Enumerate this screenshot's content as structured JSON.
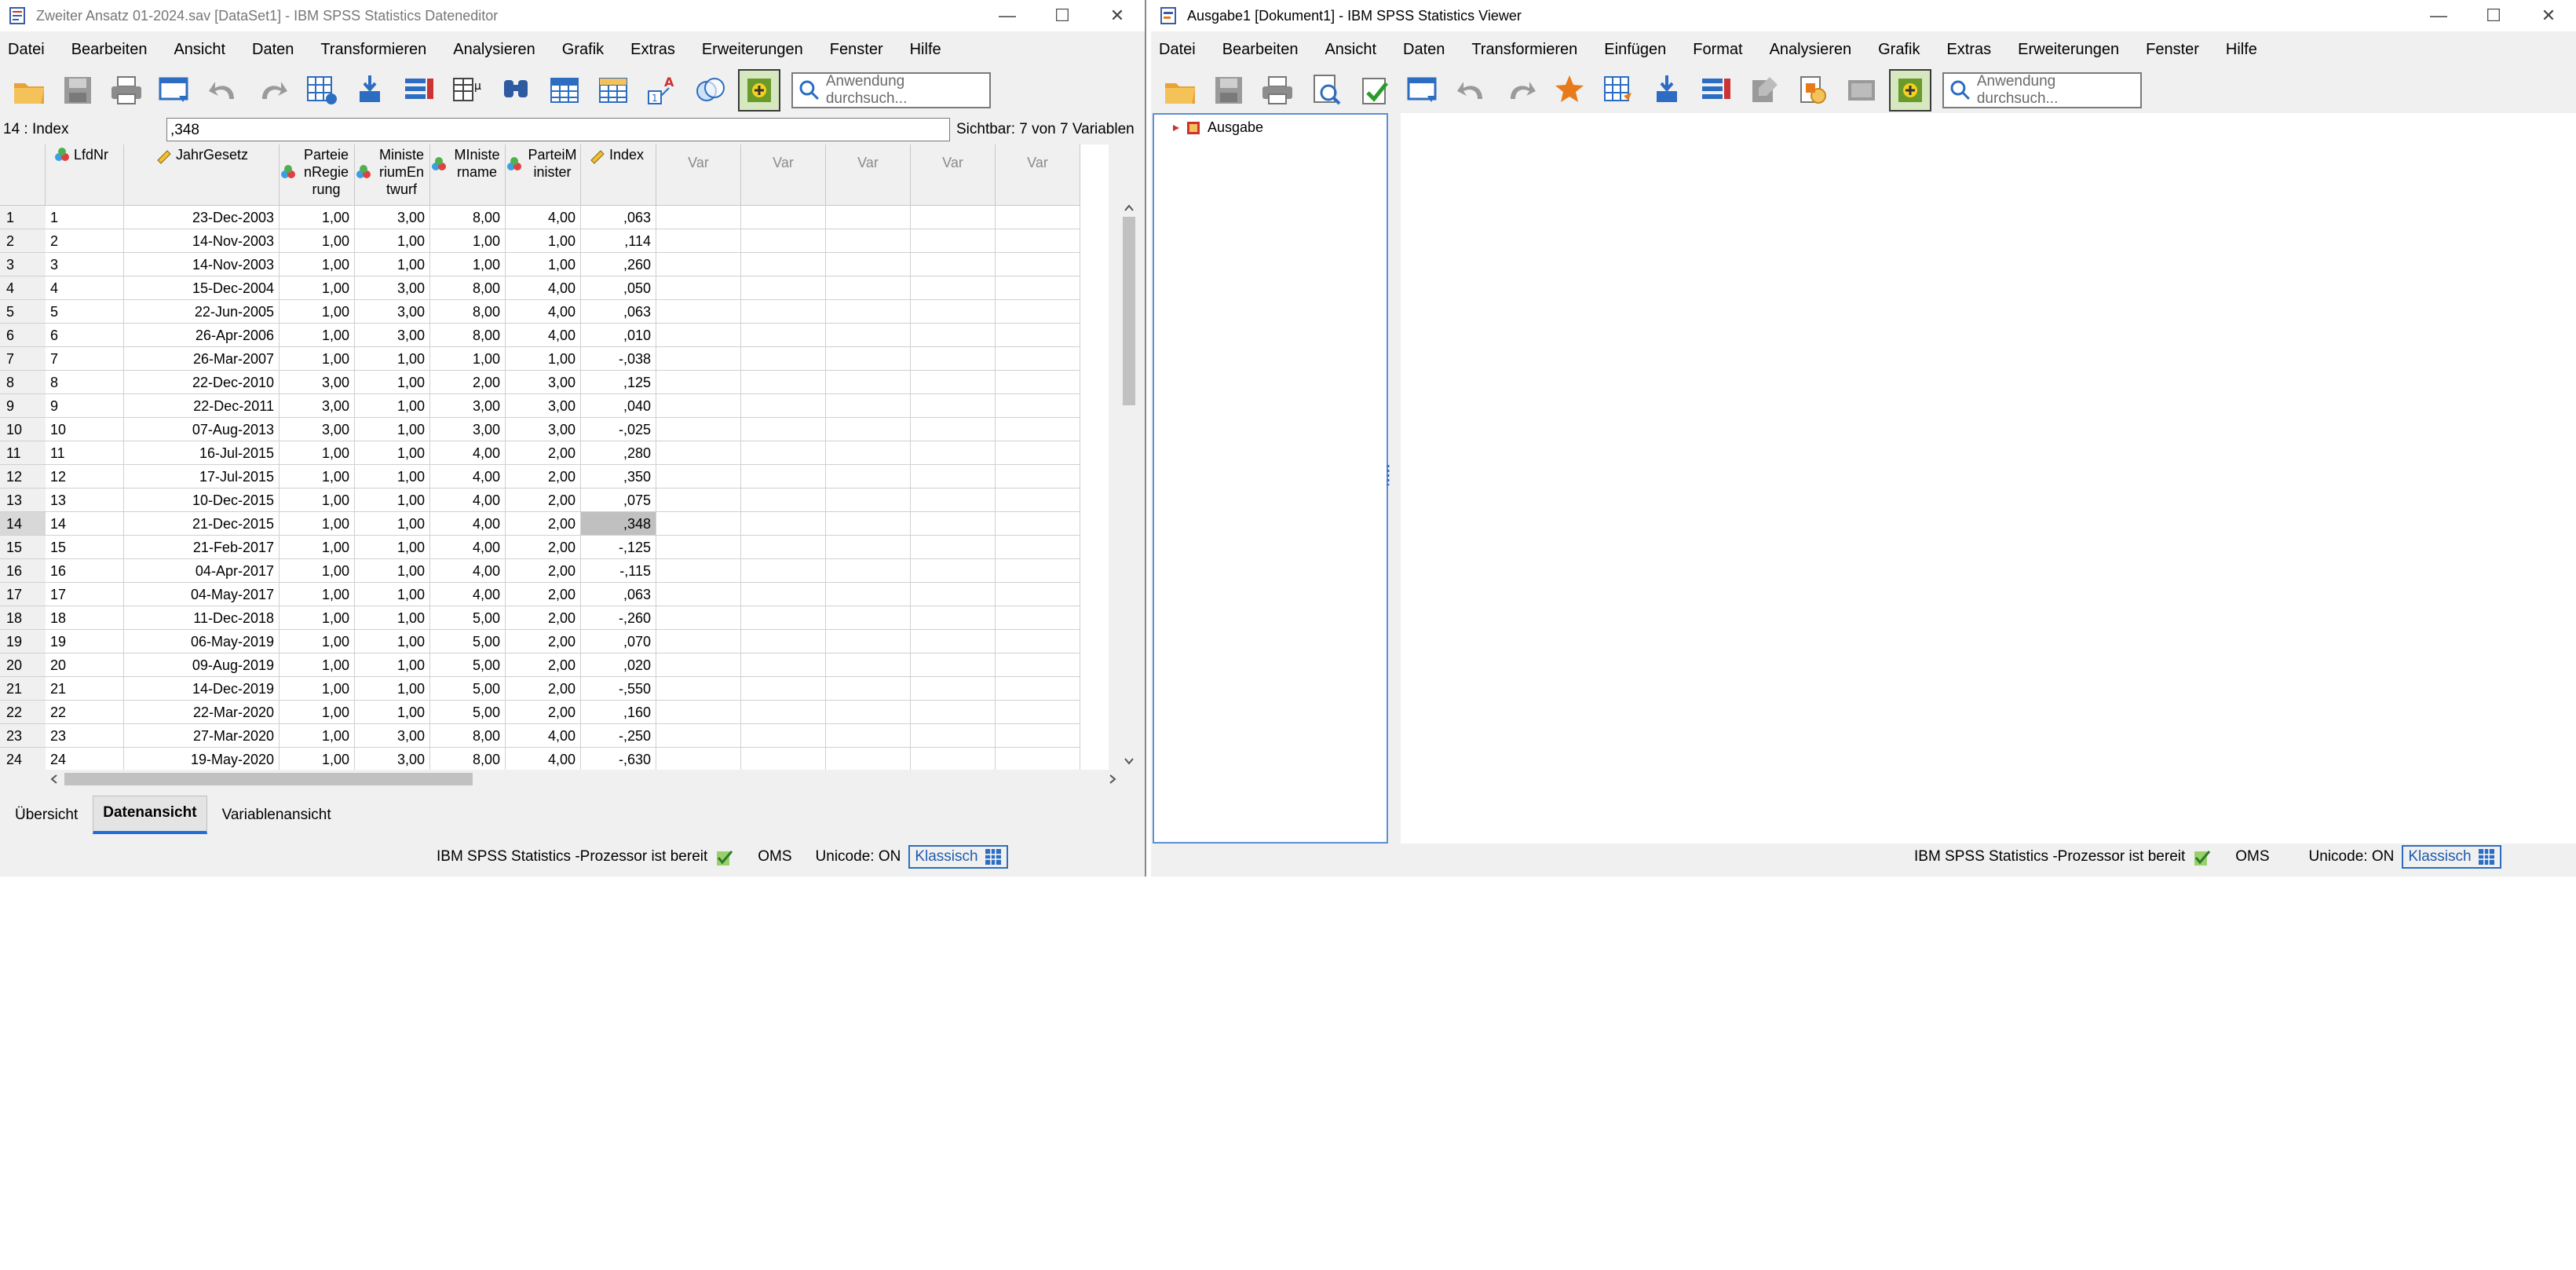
{
  "editor": {
    "title": "Zweiter Ansatz 01-2024.sav [DataSet1] - IBM SPSS Statistics Dateneditor",
    "menu": [
      "Datei",
      "Bearbeiten",
      "Ansicht",
      "Daten",
      "Transformieren",
      "Analysieren",
      "Grafik",
      "Extras",
      "Erweiterungen",
      "Fenster",
      "Hilfe"
    ],
    "search_placeholder": "Anwendung durchsuch...",
    "cell_ref": "14 : Index",
    "cell_value": ",348",
    "visible_vars": "Sichtbar: 7 von 7 Variablen",
    "columns": [
      {
        "name": "LfdNr",
        "lines": [
          "LfdNr"
        ],
        "icon": "nominal-icon"
      },
      {
        "name": "JahrGesetz",
        "lines": [
          "JahrGesetz"
        ],
        "icon": "scale-icon"
      },
      {
        "name": "ParteienRegierung",
        "lines": [
          "Parteie",
          "nRegie",
          "rung"
        ],
        "icon": "nominal-icon"
      },
      {
        "name": "MinisteriumEntwurf",
        "lines": [
          "Ministe",
          "riumEn",
          "twurf"
        ],
        "icon": "nominal-icon"
      },
      {
        "name": "Ministername",
        "lines": [
          "MIniste",
          "rname"
        ],
        "icon": "nominal-icon"
      },
      {
        "name": "ParteiMinister",
        "lines": [
          "ParteiM",
          "inister"
        ],
        "icon": "nominal-icon"
      },
      {
        "name": "Index",
        "lines": [
          "Index"
        ],
        "icon": "scale-icon"
      },
      {
        "name": "Var",
        "lines": [
          "Var"
        ],
        "icon": ""
      },
      {
        "name": "Var",
        "lines": [
          "Var"
        ],
        "icon": ""
      },
      {
        "name": "Var",
        "lines": [
          "Var"
        ],
        "icon": ""
      },
      {
        "name": "Var",
        "lines": [
          "Var"
        ],
        "icon": ""
      },
      {
        "name": "Var",
        "lines": [
          "Var"
        ],
        "icon": ""
      }
    ],
    "rows": [
      [
        "1",
        "1",
        "23-Dec-2003",
        "1,00",
        "3,00",
        "8,00",
        "4,00",
        ",063"
      ],
      [
        "2",
        "2",
        "14-Nov-2003",
        "1,00",
        "1,00",
        "1,00",
        "1,00",
        ",114"
      ],
      [
        "3",
        "3",
        "14-Nov-2003",
        "1,00",
        "1,00",
        "1,00",
        "1,00",
        ",260"
      ],
      [
        "4",
        "4",
        "15-Dec-2004",
        "1,00",
        "3,00",
        "8,00",
        "4,00",
        ",050"
      ],
      [
        "5",
        "5",
        "22-Jun-2005",
        "1,00",
        "3,00",
        "8,00",
        "4,00",
        ",063"
      ],
      [
        "6",
        "6",
        "26-Apr-2006",
        "1,00",
        "3,00",
        "8,00",
        "4,00",
        ",010"
      ],
      [
        "7",
        "7",
        "26-Mar-2007",
        "1,00",
        "1,00",
        "1,00",
        "1,00",
        "-,038"
      ],
      [
        "8",
        "8",
        "22-Dec-2010",
        "3,00",
        "1,00",
        "2,00",
        "3,00",
        ",125"
      ],
      [
        "9",
        "9",
        "22-Dec-2011",
        "3,00",
        "1,00",
        "3,00",
        "3,00",
        ",040"
      ],
      [
        "10",
        "10",
        "07-Aug-2013",
        "3,00",
        "1,00",
        "3,00",
        "3,00",
        "-,025"
      ],
      [
        "11",
        "11",
        "16-Jul-2015",
        "1,00",
        "1,00",
        "4,00",
        "2,00",
        ",280"
      ],
      [
        "12",
        "12",
        "17-Jul-2015",
        "1,00",
        "1,00",
        "4,00",
        "2,00",
        ",350"
      ],
      [
        "13",
        "13",
        "10-Dec-2015",
        "1,00",
        "1,00",
        "4,00",
        "2,00",
        ",075"
      ],
      [
        "14",
        "14",
        "21-Dec-2015",
        "1,00",
        "1,00",
        "4,00",
        "2,00",
        ",348"
      ],
      [
        "15",
        "15",
        "21-Feb-2017",
        "1,00",
        "1,00",
        "4,00",
        "2,00",
        "-,125"
      ],
      [
        "16",
        "16",
        "04-Apr-2017",
        "1,00",
        "1,00",
        "4,00",
        "2,00",
        "-,115"
      ],
      [
        "17",
        "17",
        "04-May-2017",
        "1,00",
        "1,00",
        "4,00",
        "2,00",
        ",063"
      ],
      [
        "18",
        "18",
        "11-Dec-2018",
        "1,00",
        "1,00",
        "5,00",
        "2,00",
        "-,260"
      ],
      [
        "19",
        "19",
        "06-May-2019",
        "1,00",
        "1,00",
        "5,00",
        "2,00",
        ",070"
      ],
      [
        "20",
        "20",
        "09-Aug-2019",
        "1,00",
        "1,00",
        "5,00",
        "2,00",
        ",020"
      ],
      [
        "21",
        "21",
        "14-Dec-2019",
        "1,00",
        "1,00",
        "5,00",
        "2,00",
        "-,550"
      ],
      [
        "22",
        "22",
        "22-Mar-2020",
        "1,00",
        "1,00",
        "5,00",
        "2,00",
        ",160"
      ],
      [
        "23",
        "23",
        "27-Mar-2020",
        "1,00",
        "3,00",
        "8,00",
        "4,00",
        "-,250"
      ],
      [
        "24",
        "24",
        "19-May-2020",
        "1,00",
        "3,00",
        "8,00",
        "4,00",
        "-,630"
      ]
    ],
    "selected_row": "14",
    "selected_col": "Index",
    "tabs": [
      "Übersicht",
      "Datenansicht",
      "Variablenansicht"
    ],
    "active_tab": "Datenansicht",
    "status": {
      "processor": "IBM SPSS Statistics -Prozessor ist bereit",
      "oms": "OMS",
      "unicode": "Unicode: ON",
      "mode": "Klassisch"
    }
  },
  "viewer": {
    "title": "Ausgabe1 [Dokument1] - IBM SPSS Statistics Viewer",
    "menu": [
      "Datei",
      "Bearbeiten",
      "Ansicht",
      "Daten",
      "Transformieren",
      "Einfügen",
      "Format",
      "Analysieren",
      "Grafik",
      "Extras",
      "Erweiterungen",
      "Fenster",
      "Hilfe"
    ],
    "search_placeholder": "Anwendung durchsuch...",
    "outline_root": "Ausgabe",
    "status": {
      "processor": "IBM SPSS Statistics -Prozessor ist bereit",
      "oms": "OMS",
      "unicode": "Unicode: ON",
      "mode": "Klassisch"
    }
  },
  "colors": {
    "accent": "#1e6ed6",
    "selected_cell": "#c0c0c0",
    "window_bg": "#f0f0f0"
  }
}
